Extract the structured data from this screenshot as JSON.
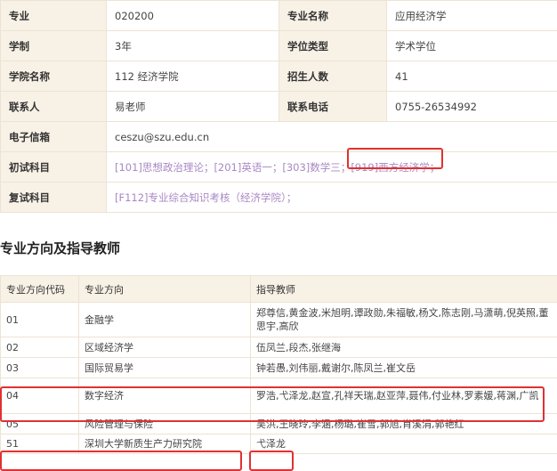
{
  "info": {
    "rows": [
      [
        {
          "label": "专业",
          "value": "020200"
        },
        {
          "label": "专业名称",
          "value": "应用经济学"
        }
      ],
      [
        {
          "label": "学制",
          "value": "3年"
        },
        {
          "label": "学位类型",
          "value": "学术学位"
        }
      ],
      [
        {
          "label": "学院名称",
          "value": "112 经济学院"
        },
        {
          "label": "招生人数",
          "value": "41"
        }
      ],
      [
        {
          "label": "联系人",
          "value": "易老师"
        },
        {
          "label": "联系电话",
          "value": "0755-26534992"
        }
      ]
    ],
    "email_label": "电子信箱",
    "email_value": "ceszu@szu.edu.cn",
    "prelim_label": "初试科目",
    "prelim_subjects": [
      "[101]思想政治理论；",
      "[201]英语一；",
      "[303]数学三；",
      "[919]西方经济学；"
    ],
    "retest_label": "复试科目",
    "retest_subjects": [
      "[F112]专业综合知识考核（经济学院）；"
    ]
  },
  "section_title": "专业方向及指导教师",
  "directions": {
    "headers": [
      "专业方向代码",
      "专业方向",
      "指导教师"
    ],
    "rows": [
      {
        "code": "01",
        "name": "金融学",
        "teachers": "郑尊信,黄金波,米旭明,谭政勋,朱福敏,杨文,陈志刚,马潇萌,倪英照,董思宇,高欣"
      },
      {
        "code": "02",
        "name": "区域经济学",
        "teachers": "伍凤兰,段杰,张继海"
      },
      {
        "code": "03",
        "name": "国际贸易学",
        "teachers": "钟若愚,刘伟丽,戴谢尔,陈凤兰,崔文岳"
      },
      {
        "code": "04",
        "name": "数字经济",
        "teachers": "罗浩,弋泽龙,赵宣,孔祥天瑞,赵亚萍,聂伟,付业林,罗素媛,蒋渊,广凯"
      },
      {
        "code": "05",
        "name": "风险管理与保险",
        "teachers": "吴洪,王晓玲,李涵,杨璐,崔雪,郭旭,肖溪涓,郭艳红"
      },
      {
        "code": "51",
        "name": "深圳大学新质生产力研究院",
        "teachers": "弋泽龙"
      }
    ]
  },
  "highlight_color": "#e03131",
  "link_color": "#a987c4",
  "header_bg": "#f8f1e6"
}
